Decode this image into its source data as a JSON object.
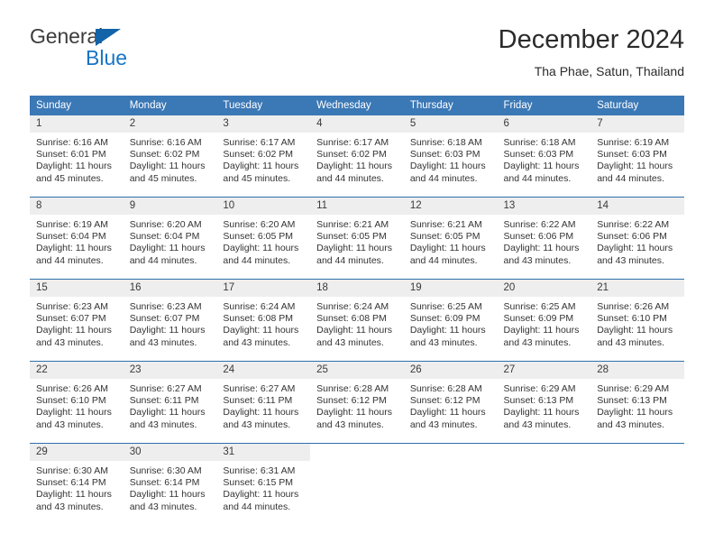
{
  "brand": {
    "name_part1": "General",
    "name_part2": "Blue",
    "triangle_color": "#1263a8",
    "blue_color": "#1774c4"
  },
  "header": {
    "title": "December 2024",
    "subtitle": "Tha Phae, Satun, Thailand"
  },
  "theme": {
    "header_bg": "#3b78b6",
    "row_border": "#2f6fae",
    "daynum_bg": "#eeeeee"
  },
  "calendar": {
    "weekdays": [
      "Sunday",
      "Monday",
      "Tuesday",
      "Wednesday",
      "Thursday",
      "Friday",
      "Saturday"
    ],
    "weeks": [
      [
        {
          "day": "1",
          "sunrise": "Sunrise: 6:16 AM",
          "sunset": "Sunset: 6:01 PM",
          "daylight_line1": "Daylight: 11 hours",
          "daylight_line2": "and 45 minutes."
        },
        {
          "day": "2",
          "sunrise": "Sunrise: 6:16 AM",
          "sunset": "Sunset: 6:02 PM",
          "daylight_line1": "Daylight: 11 hours",
          "daylight_line2": "and 45 minutes."
        },
        {
          "day": "3",
          "sunrise": "Sunrise: 6:17 AM",
          "sunset": "Sunset: 6:02 PM",
          "daylight_line1": "Daylight: 11 hours",
          "daylight_line2": "and 45 minutes."
        },
        {
          "day": "4",
          "sunrise": "Sunrise: 6:17 AM",
          "sunset": "Sunset: 6:02 PM",
          "daylight_line1": "Daylight: 11 hours",
          "daylight_line2": "and 44 minutes."
        },
        {
          "day": "5",
          "sunrise": "Sunrise: 6:18 AM",
          "sunset": "Sunset: 6:03 PM",
          "daylight_line1": "Daylight: 11 hours",
          "daylight_line2": "and 44 minutes."
        },
        {
          "day": "6",
          "sunrise": "Sunrise: 6:18 AM",
          "sunset": "Sunset: 6:03 PM",
          "daylight_line1": "Daylight: 11 hours",
          "daylight_line2": "and 44 minutes."
        },
        {
          "day": "7",
          "sunrise": "Sunrise: 6:19 AM",
          "sunset": "Sunset: 6:03 PM",
          "daylight_line1": "Daylight: 11 hours",
          "daylight_line2": "and 44 minutes."
        }
      ],
      [
        {
          "day": "8",
          "sunrise": "Sunrise: 6:19 AM",
          "sunset": "Sunset: 6:04 PM",
          "daylight_line1": "Daylight: 11 hours",
          "daylight_line2": "and 44 minutes."
        },
        {
          "day": "9",
          "sunrise": "Sunrise: 6:20 AM",
          "sunset": "Sunset: 6:04 PM",
          "daylight_line1": "Daylight: 11 hours",
          "daylight_line2": "and 44 minutes."
        },
        {
          "day": "10",
          "sunrise": "Sunrise: 6:20 AM",
          "sunset": "Sunset: 6:05 PM",
          "daylight_line1": "Daylight: 11 hours",
          "daylight_line2": "and 44 minutes."
        },
        {
          "day": "11",
          "sunrise": "Sunrise: 6:21 AM",
          "sunset": "Sunset: 6:05 PM",
          "daylight_line1": "Daylight: 11 hours",
          "daylight_line2": "and 44 minutes."
        },
        {
          "day": "12",
          "sunrise": "Sunrise: 6:21 AM",
          "sunset": "Sunset: 6:05 PM",
          "daylight_line1": "Daylight: 11 hours",
          "daylight_line2": "and 44 minutes."
        },
        {
          "day": "13",
          "sunrise": "Sunrise: 6:22 AM",
          "sunset": "Sunset: 6:06 PM",
          "daylight_line1": "Daylight: 11 hours",
          "daylight_line2": "and 43 minutes."
        },
        {
          "day": "14",
          "sunrise": "Sunrise: 6:22 AM",
          "sunset": "Sunset: 6:06 PM",
          "daylight_line1": "Daylight: 11 hours",
          "daylight_line2": "and 43 minutes."
        }
      ],
      [
        {
          "day": "15",
          "sunrise": "Sunrise: 6:23 AM",
          "sunset": "Sunset: 6:07 PM",
          "daylight_line1": "Daylight: 11 hours",
          "daylight_line2": "and 43 minutes."
        },
        {
          "day": "16",
          "sunrise": "Sunrise: 6:23 AM",
          "sunset": "Sunset: 6:07 PM",
          "daylight_line1": "Daylight: 11 hours",
          "daylight_line2": "and 43 minutes."
        },
        {
          "day": "17",
          "sunrise": "Sunrise: 6:24 AM",
          "sunset": "Sunset: 6:08 PM",
          "daylight_line1": "Daylight: 11 hours",
          "daylight_line2": "and 43 minutes."
        },
        {
          "day": "18",
          "sunrise": "Sunrise: 6:24 AM",
          "sunset": "Sunset: 6:08 PM",
          "daylight_line1": "Daylight: 11 hours",
          "daylight_line2": "and 43 minutes."
        },
        {
          "day": "19",
          "sunrise": "Sunrise: 6:25 AM",
          "sunset": "Sunset: 6:09 PM",
          "daylight_line1": "Daylight: 11 hours",
          "daylight_line2": "and 43 minutes."
        },
        {
          "day": "20",
          "sunrise": "Sunrise: 6:25 AM",
          "sunset": "Sunset: 6:09 PM",
          "daylight_line1": "Daylight: 11 hours",
          "daylight_line2": "and 43 minutes."
        },
        {
          "day": "21",
          "sunrise": "Sunrise: 6:26 AM",
          "sunset": "Sunset: 6:10 PM",
          "daylight_line1": "Daylight: 11 hours",
          "daylight_line2": "and 43 minutes."
        }
      ],
      [
        {
          "day": "22",
          "sunrise": "Sunrise: 6:26 AM",
          "sunset": "Sunset: 6:10 PM",
          "daylight_line1": "Daylight: 11 hours",
          "daylight_line2": "and 43 minutes."
        },
        {
          "day": "23",
          "sunrise": "Sunrise: 6:27 AM",
          "sunset": "Sunset: 6:11 PM",
          "daylight_line1": "Daylight: 11 hours",
          "daylight_line2": "and 43 minutes."
        },
        {
          "day": "24",
          "sunrise": "Sunrise: 6:27 AM",
          "sunset": "Sunset: 6:11 PM",
          "daylight_line1": "Daylight: 11 hours",
          "daylight_line2": "and 43 minutes."
        },
        {
          "day": "25",
          "sunrise": "Sunrise: 6:28 AM",
          "sunset": "Sunset: 6:12 PM",
          "daylight_line1": "Daylight: 11 hours",
          "daylight_line2": "and 43 minutes."
        },
        {
          "day": "26",
          "sunrise": "Sunrise: 6:28 AM",
          "sunset": "Sunset: 6:12 PM",
          "daylight_line1": "Daylight: 11 hours",
          "daylight_line2": "and 43 minutes."
        },
        {
          "day": "27",
          "sunrise": "Sunrise: 6:29 AM",
          "sunset": "Sunset: 6:13 PM",
          "daylight_line1": "Daylight: 11 hours",
          "daylight_line2": "and 43 minutes."
        },
        {
          "day": "28",
          "sunrise": "Sunrise: 6:29 AM",
          "sunset": "Sunset: 6:13 PM",
          "daylight_line1": "Daylight: 11 hours",
          "daylight_line2": "and 43 minutes."
        }
      ],
      [
        {
          "day": "29",
          "sunrise": "Sunrise: 6:30 AM",
          "sunset": "Sunset: 6:14 PM",
          "daylight_line1": "Daylight: 11 hours",
          "daylight_line2": "and 43 minutes."
        },
        {
          "day": "30",
          "sunrise": "Sunrise: 6:30 AM",
          "sunset": "Sunset: 6:14 PM",
          "daylight_line1": "Daylight: 11 hours",
          "daylight_line2": "and 43 minutes."
        },
        {
          "day": "31",
          "sunrise": "Sunrise: 6:31 AM",
          "sunset": "Sunset: 6:15 PM",
          "daylight_line1": "Daylight: 11 hours",
          "daylight_line2": "and 44 minutes."
        },
        {
          "day": "",
          "sunrise": "",
          "sunset": "",
          "daylight_line1": "",
          "daylight_line2": ""
        },
        {
          "day": "",
          "sunrise": "",
          "sunset": "",
          "daylight_line1": "",
          "daylight_line2": ""
        },
        {
          "day": "",
          "sunrise": "",
          "sunset": "",
          "daylight_line1": "",
          "daylight_line2": ""
        },
        {
          "day": "",
          "sunrise": "",
          "sunset": "",
          "daylight_line1": "",
          "daylight_line2": ""
        }
      ]
    ]
  }
}
